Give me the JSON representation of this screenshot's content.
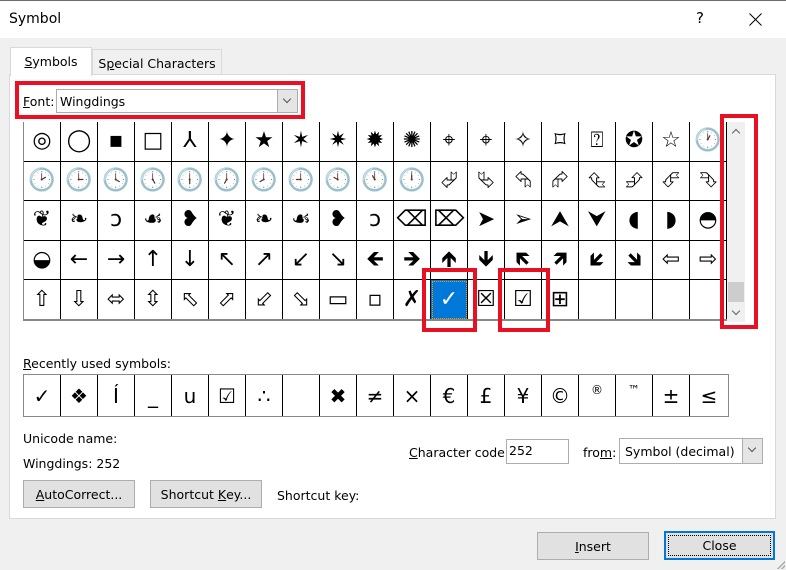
{
  "window": {
    "title": "Symbol",
    "help_label": "?",
    "close_icon": "close-x-icon"
  },
  "tabs": [
    {
      "label": "Symbols",
      "accel": "S",
      "rest": "ymbols",
      "active": true
    },
    {
      "label": "Special Characters",
      "pre": "S",
      "accel": "p",
      "rest": "ecial Characters",
      "active": false
    }
  ],
  "font": {
    "label_accel": "F",
    "label_rest": "ont:",
    "value": "Wingdings"
  },
  "symbol_grid": {
    "rows": [
      [
        "◎",
        "◯",
        "▪",
        "□",
        "⅄",
        "✦",
        "★",
        "✶",
        "✷",
        "✹",
        "✺",
        "⌖",
        "⌖",
        "✧",
        "⌑",
        "⍰",
        "✪",
        "☆",
        "🕐"
      ],
      [
        "🕑",
        "🕒",
        "🕓",
        "🕔",
        "🕕",
        "🕖",
        "🕗",
        "🕘",
        "🕙",
        "🕚",
        "🕛",
        "⮰",
        "⮱",
        "⮲",
        "⮳",
        "⮴",
        "⮵",
        "⮶",
        "⮷"
      ],
      [
        "❦",
        "❧",
        "ↄ",
        "☙",
        "❥",
        "❦",
        "❧",
        "☙",
        "❥",
        "ↄ",
        "⌫",
        "⌦",
        "➤",
        "➢",
        "⮝",
        "⮟",
        "◖",
        "◗",
        "◓"
      ],
      [
        "◒",
        "←",
        "→",
        "↑",
        "↓",
        "↖",
        "↗",
        "↙",
        "↘",
        "🡸",
        "🡺",
        "🡹",
        "🡻",
        "🡼",
        "🡽",
        "🡿",
        "🡾",
        "⇦",
        "⇨"
      ],
      [
        "⇧",
        "⇩",
        "⬄",
        "⇳",
        "⬁",
        "⬀",
        "⬃",
        "⬂",
        "▭",
        "▫",
        "✗",
        "✓",
        "☒",
        "☑",
        "⊞",
        "",
        "",
        "",
        ""
      ]
    ],
    "selected": {
      "row": 4,
      "col": 11,
      "symbol": "✓"
    }
  },
  "recent": {
    "label_accel": "R",
    "label_rest": "ecently used symbols:",
    "symbols": [
      "✓",
      "❖",
      "Í",
      "_",
      "u",
      "☑",
      "∴",
      " ",
      "✖",
      "≠",
      "×",
      "€",
      "£",
      "¥",
      "©",
      "®",
      "™",
      "±",
      "≤"
    ]
  },
  "info": {
    "unicode_name_label": "Unicode name:",
    "font_code": "Wingdings: 252",
    "char_code_accel": "C",
    "char_code_rest": "haracter code:",
    "char_code_value": "252",
    "from_pre": "fro",
    "from_accel": "m",
    "from_post": ":",
    "from_value": "Symbol (decimal)"
  },
  "buttons": {
    "autocorrect_accel": "A",
    "autocorrect_rest": "utoCorrect...",
    "shortcut_pre": "Shortcut ",
    "shortcut_accel": "K",
    "shortcut_rest": "ey...",
    "shortcut_key_label": "Shortcut key:",
    "insert_accel": "I",
    "insert_rest": "nsert",
    "close": "Close"
  },
  "highlight_color": "#e81123",
  "selection_color": "#0078d7"
}
